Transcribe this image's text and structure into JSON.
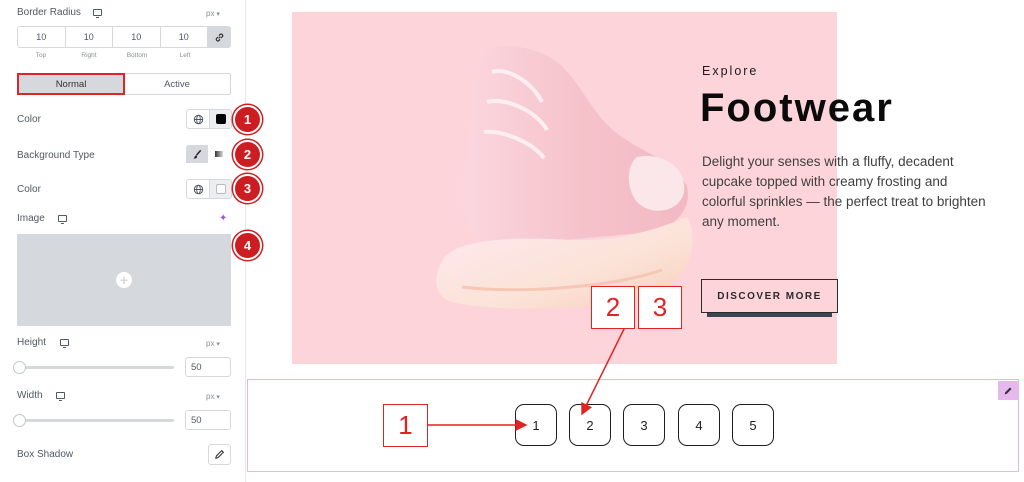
{
  "panel": {
    "border_radius": {
      "label": "Border Radius",
      "unit": "px",
      "values": [
        "10",
        "10",
        "10",
        "10"
      ],
      "captions": [
        "Top",
        "Right",
        "Bottom",
        "Left"
      ]
    },
    "tabs": [
      "Normal",
      "Active"
    ],
    "color_label": "Color",
    "background_type_label": "Background Type",
    "color2_label": "Color",
    "image_label": "Image",
    "height": {
      "label": "Height",
      "unit": "px",
      "value": "50"
    },
    "width": {
      "label": "Width",
      "unit": "px",
      "value": "50"
    },
    "box_shadow_label": "Box Shadow"
  },
  "badges": [
    "1",
    "2",
    "3",
    "4"
  ],
  "preview": {
    "kicker": "Explore",
    "headline": "Footwear",
    "description": "Delight your senses with a fluffy, decadent cupcake topped with creamy frosting and colorful sprinkles — the perfect treat to brighten any moment.",
    "cta": "DISCOVER MORE",
    "hero_bg": "#fed4db"
  },
  "pagination": [
    "1",
    "2",
    "3",
    "4",
    "5"
  ],
  "callouts": [
    "1",
    "2",
    "3"
  ],
  "colors": {
    "accent_red": "#e02424",
    "badge_red": "#cc1e22",
    "panel_gray": "#d5d8dc"
  }
}
